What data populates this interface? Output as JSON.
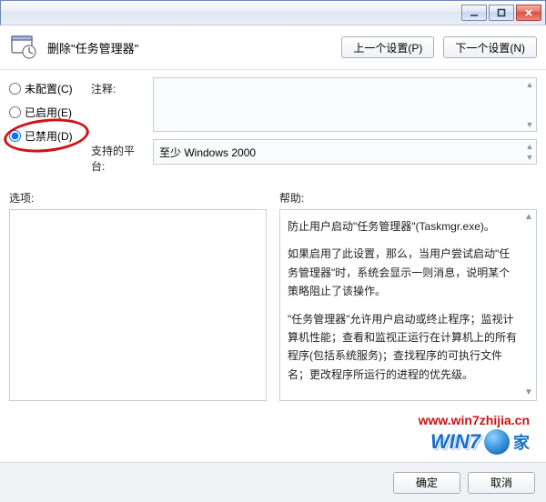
{
  "window": {
    "min_title": "minimize",
    "max_title": "maximize",
    "close_title": "close"
  },
  "header": {
    "title": "删除\"任务管理器\"",
    "prev_button": "上一个设置(P)",
    "next_button": "下一个设置(N)"
  },
  "radios": {
    "not_configured": "未配置(C)",
    "enabled": "已启用(E)",
    "disabled": "已禁用(D)",
    "selected": "disabled"
  },
  "comment": {
    "label": "注释:",
    "value": ""
  },
  "platform": {
    "label": "支持的平台:",
    "value": "至少 Windows 2000"
  },
  "options": {
    "label": "选项:",
    "value": ""
  },
  "help": {
    "label": "帮助:",
    "paras": [
      "防止用户启动\"任务管理器\"(Taskmgr.exe)。",
      "如果启用了此设置，那么，当用户尝试启动\"任务管理器\"时，系统会显示一则消息，说明某个策略阻止了该操作。",
      "\"任务管理器\"允许用户启动或终止程序；监视计算机性能；查看和监视正运行在计算机上的所有程序(包括系统服务)；查找程序的可执行文件名；更改程序所运行的进程的优先级。"
    ]
  },
  "footer": {
    "ok": "确定",
    "cancel": "取消"
  },
  "watermark": {
    "url": "www.win7zhijia.cn",
    "brand": "WIN7",
    "suffix": "家"
  }
}
